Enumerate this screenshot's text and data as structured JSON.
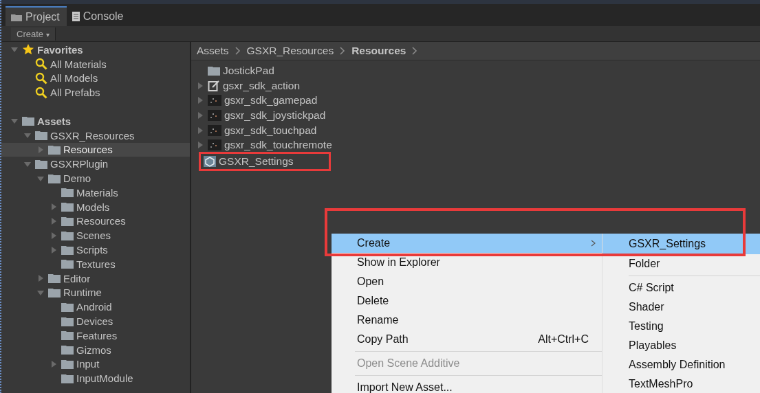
{
  "tabs": [
    {
      "label": "Project",
      "selected": true
    },
    {
      "label": "Console",
      "selected": false
    }
  ],
  "toolbar": {
    "create_button": "Create",
    "dropdown_glyph": "▾"
  },
  "tree": [
    {
      "label": "Favorites",
      "kind": "favorites",
      "expanded": true,
      "selected": false,
      "children": [
        {
          "label": "All Materials",
          "kind": "search",
          "selected": false
        },
        {
          "label": "All Models",
          "kind": "search",
          "selected": false
        },
        {
          "label": "All Prefabs",
          "kind": "search",
          "selected": false
        }
      ]
    },
    {
      "label": "Assets",
      "kind": "root",
      "expanded": true,
      "selected": false,
      "children": [
        {
          "label": "GSXR_Resources",
          "kind": "folder",
          "expanded": true,
          "selected": false,
          "children": [
            {
              "label": "Resources",
              "kind": "folder",
              "expanded": false,
              "selected": true
            }
          ]
        },
        {
          "label": "GSXRPlugin",
          "kind": "folder",
          "expanded": true,
          "selected": false,
          "children": [
            {
              "label": "Demo",
              "kind": "folder",
              "expanded": true,
              "selected": false,
              "children": [
                {
                  "label": "Materials",
                  "kind": "folder",
                  "selected": false
                },
                {
                  "label": "Models",
                  "kind": "folder",
                  "expanded": false,
                  "selected": false
                },
                {
                  "label": "Resources",
                  "kind": "folder",
                  "expanded": false,
                  "selected": false
                },
                {
                  "label": "Scenes",
                  "kind": "folder",
                  "expanded": false,
                  "selected": false
                },
                {
                  "label": "Scripts",
                  "kind": "folder",
                  "expanded": false,
                  "selected": false
                },
                {
                  "label": "Textures",
                  "kind": "folder",
                  "selected": false
                }
              ]
            },
            {
              "label": "Editor",
              "kind": "folder",
              "expanded": false,
              "selected": false
            },
            {
              "label": "Runtime",
              "kind": "folder",
              "expanded": true,
              "selected": false,
              "children": [
                {
                  "label": "Android",
                  "kind": "folder",
                  "selected": false
                },
                {
                  "label": "Devices",
                  "kind": "folder",
                  "selected": false
                },
                {
                  "label": "Features",
                  "kind": "folder",
                  "selected": false
                },
                {
                  "label": "Gizmos",
                  "kind": "folder",
                  "selected": false
                },
                {
                  "label": "Input",
                  "kind": "folder",
                  "expanded": false,
                  "selected": false
                },
                {
                  "label": "InputModule",
                  "kind": "folder",
                  "selected": false
                }
              ]
            }
          ]
        }
      ]
    }
  ],
  "breadcrumb": [
    {
      "label": "Assets",
      "current": false
    },
    {
      "label": "GSXR_Resources",
      "current": false
    },
    {
      "label": "Resources",
      "current": true
    }
  ],
  "files": [
    {
      "label": "JostickPad",
      "kind": "folder",
      "highlighted": false
    },
    {
      "label": "gsxr_sdk_action",
      "kind": "script",
      "expanded": false,
      "highlighted": false
    },
    {
      "label": "gsxr_sdk_gamepad",
      "kind": "texture",
      "expanded": false,
      "highlighted": false
    },
    {
      "label": "gsxr_sdk_joystickpad",
      "kind": "texture",
      "expanded": false,
      "highlighted": false
    },
    {
      "label": "gsxr_sdk_touchpad",
      "kind": "texture",
      "expanded": false,
      "highlighted": false
    },
    {
      "label": "gsxr_sdk_touchremote",
      "kind": "texture",
      "expanded": false,
      "highlighted": false
    },
    {
      "label": "GSXR_Settings",
      "kind": "settings",
      "highlighted": true
    }
  ],
  "context_menu": [
    {
      "kind": "item",
      "label": "Create",
      "submenu": true,
      "selected": true
    },
    {
      "kind": "item",
      "label": "Show in Explorer",
      "selected": false
    },
    {
      "kind": "item",
      "label": "Open",
      "selected": false
    },
    {
      "kind": "item",
      "label": "Delete",
      "selected": false
    },
    {
      "kind": "item",
      "label": "Rename",
      "selected": false
    },
    {
      "kind": "item",
      "label": "Copy Path",
      "shortcut": "Alt+Ctrl+C",
      "selected": false
    },
    {
      "kind": "separator"
    },
    {
      "kind": "disabled",
      "label": "Open Scene Additive"
    },
    {
      "kind": "separator"
    },
    {
      "kind": "item",
      "label": "Import New Asset...",
      "selected": false
    }
  ],
  "submenu": [
    {
      "kind": "item",
      "label": "GSXR_Settings",
      "selected": true
    },
    {
      "kind": "item",
      "label": "Folder",
      "selected": false
    },
    {
      "kind": "separator"
    },
    {
      "kind": "item",
      "label": "C# Script",
      "selected": false
    },
    {
      "kind": "item",
      "label": "Shader",
      "selected": false
    },
    {
      "kind": "item",
      "label": "Testing",
      "selected": false
    },
    {
      "kind": "item",
      "label": "Playables",
      "selected": false
    },
    {
      "kind": "item",
      "label": "Assembly Definition",
      "selected": false
    },
    {
      "kind": "item",
      "label": "TextMeshPro",
      "selected": false
    }
  ],
  "annotation": {
    "menu_highlight": true
  }
}
